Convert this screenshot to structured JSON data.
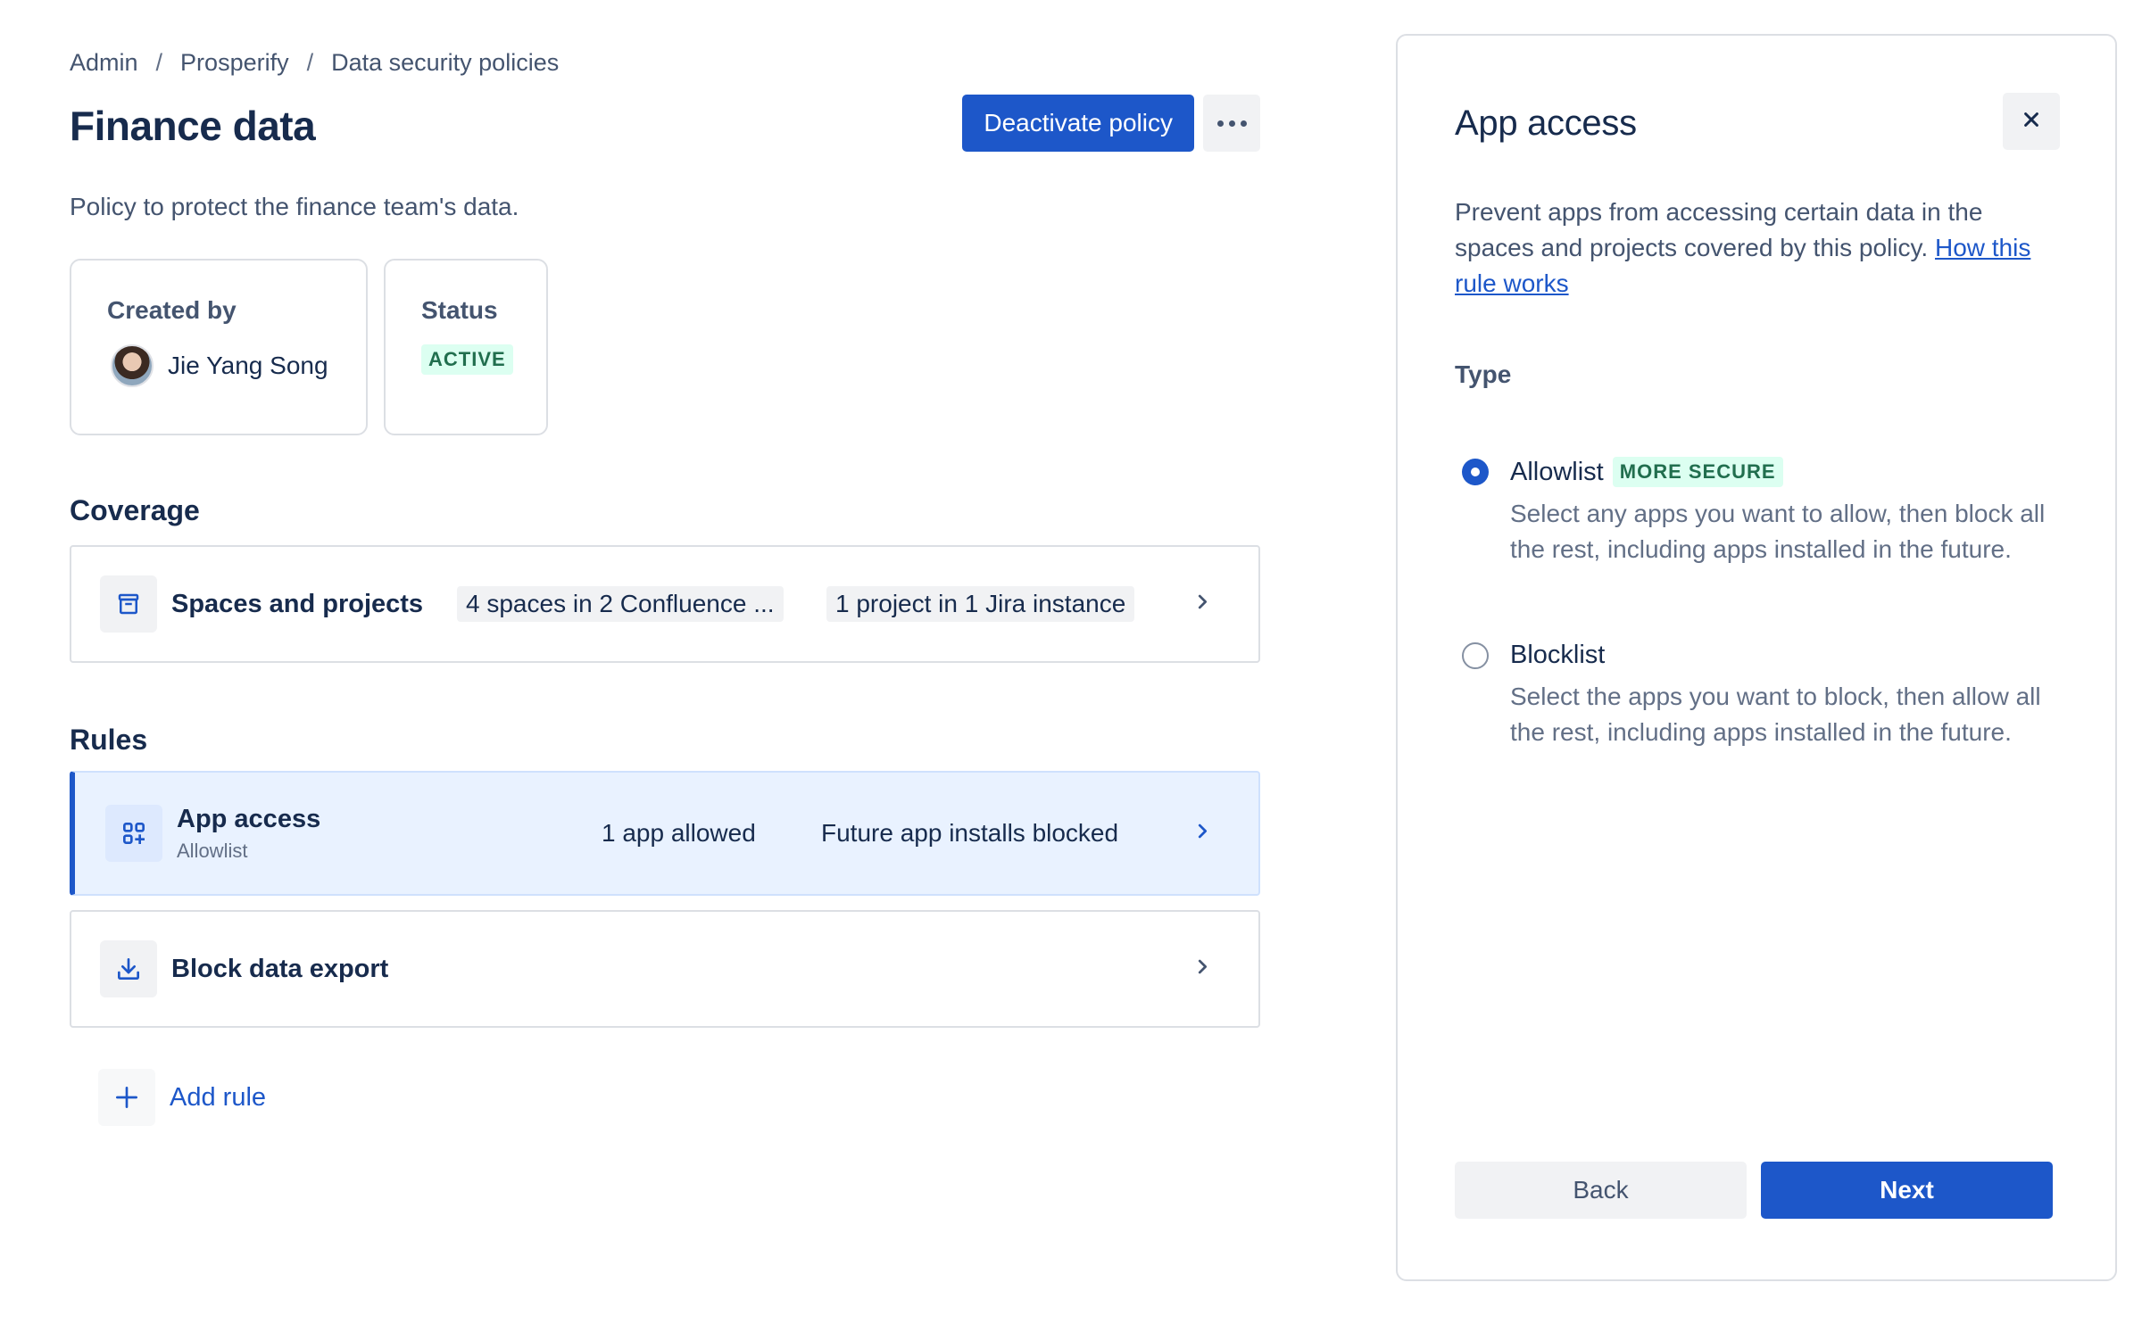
{
  "breadcrumb": {
    "items": [
      "Admin",
      "Prosperify",
      "Data security policies"
    ],
    "separator": "/"
  },
  "header": {
    "title": "Finance data",
    "deactivate_label": "Deactivate policy",
    "more_icon": "more-horizontal-icon"
  },
  "description": "Policy to protect the finance team's data.",
  "created_by": {
    "label": "Created by",
    "name": "Jie Yang Song"
  },
  "status": {
    "label": "Status",
    "value": "ACTIVE"
  },
  "coverage": {
    "title": "Coverage",
    "row": {
      "icon": "archive-box-icon",
      "title": "Spaces and projects",
      "tag1": "4 spaces in 2 Confluence ...",
      "tag2": "1 project in 1 Jira instance"
    }
  },
  "rules": {
    "title": "Rules",
    "items": [
      {
        "icon": "apps-add-icon",
        "title": "App access",
        "subtitle": "Allowlist",
        "tag1": "1 app allowed",
        "tag2": "Future app installs blocked",
        "selected": true
      },
      {
        "icon": "download-icon",
        "title": "Block data export",
        "selected": false
      }
    ],
    "add_label": "Add rule"
  },
  "panel": {
    "title": "App access",
    "description": "Prevent apps from accessing certain data in the spaces and projects covered by this policy. ",
    "link": "How this rule works",
    "type_label": "Type",
    "options": [
      {
        "label": "Allowlist",
        "badge": "MORE SECURE",
        "description": "Select any apps you want to allow, then block all the rest, including apps installed in the future.",
        "checked": true
      },
      {
        "label": "Blocklist",
        "description": "Select the apps you want to block, then allow all the rest, including apps installed in the future.",
        "checked": false
      }
    ],
    "back_label": "Back",
    "next_label": "Next"
  },
  "colors": {
    "primary": "#1d57c9",
    "selected_row_bg": "#e9f2ff",
    "success_bg": "#dcfff1",
    "success_text": "#216e4e",
    "text": "#172b4d",
    "subtle_text": "#44546f"
  }
}
